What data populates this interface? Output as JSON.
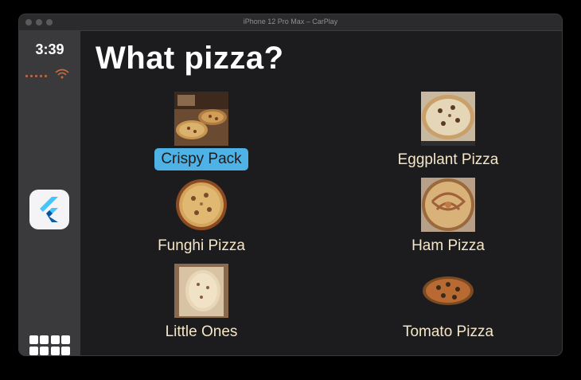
{
  "window": {
    "title": "iPhone 12 Pro Max – CarPlay"
  },
  "status": {
    "time": "3:39"
  },
  "sidebar": {
    "app_icon": "flutter-icon",
    "home_icon": "app-grid-icon"
  },
  "page": {
    "title": "What pizza?"
  },
  "items": [
    {
      "label": "Crispy Pack",
      "selected": true
    },
    {
      "label": "Eggplant Pizza",
      "selected": false
    },
    {
      "label": "Funghi Pizza",
      "selected": false
    },
    {
      "label": "Ham Pizza",
      "selected": false
    },
    {
      "label": "Little Ones",
      "selected": false
    },
    {
      "label": "Tomato Pizza",
      "selected": false
    }
  ],
  "colors": {
    "accent": "#4fb2e6",
    "label": "#f5e6c8",
    "background": "#1c1c1e",
    "sidebar": "#3a3a3c"
  }
}
